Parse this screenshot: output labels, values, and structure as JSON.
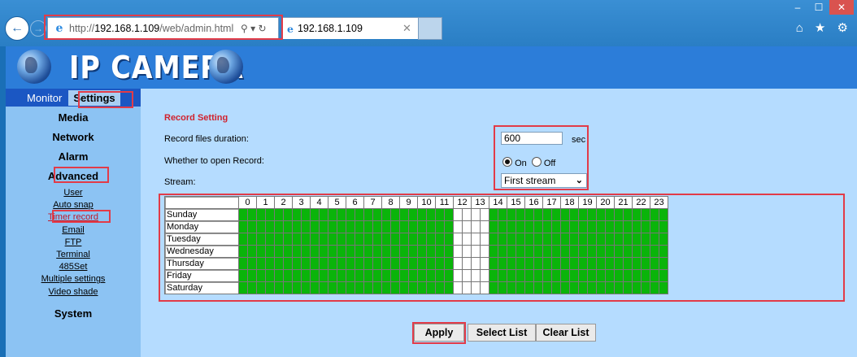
{
  "browser": {
    "url": "http://192.168.1.109/web/admin.html",
    "url_prefix": "http://",
    "url_host": "192.168.1.109",
    "url_path": "/web/admin.html",
    "tab_title": "192.168.1.109",
    "search_glyph": "⚲ ▾ ↻",
    "window_minimize": "–",
    "window_maximize": "☐",
    "window_close": "✕",
    "toolbar_icons": "⌂ ★ ⚙",
    "ie_glyph": "e"
  },
  "banner": {
    "title": "IP CAMERA"
  },
  "topnav": {
    "monitor": "Monitor",
    "settings": "Settings"
  },
  "sidebar": {
    "media": "Media",
    "network": "Network",
    "alarm": "Alarm",
    "advanced": "Advanced",
    "sub_items": [
      "User",
      "Auto snap",
      "Timer record",
      "Email",
      "FTP",
      "Terminal",
      "485Set",
      "Multiple settings",
      "Video shade"
    ],
    "system": "System"
  },
  "form": {
    "section_title": "Record Setting",
    "duration_label": "Record files duration:",
    "duration_value": "600",
    "duration_unit": "sec",
    "record_label": "Whether to open Record:",
    "on_label": "On",
    "off_label": "Off",
    "record_selected": "On",
    "stream_label": "Stream:",
    "stream_value": "First stream"
  },
  "schedule": {
    "hours": [
      "0",
      "1",
      "2",
      "3",
      "4",
      "5",
      "6",
      "7",
      "8",
      "9",
      "10",
      "11",
      "12",
      "13",
      "14",
      "15",
      "16",
      "17",
      "18",
      "19",
      "20",
      "21",
      "22",
      "23"
    ],
    "days": [
      "Sunday",
      "Monday",
      "Tuesday",
      "Wednesday",
      "Thursday",
      "Friday",
      "Saturday"
    ],
    "half_hour_slots_per_hour": 2,
    "recording_hours_off": [
      12,
      13
    ],
    "on_color": "#0ab40a",
    "off_color": "#ffffff"
  },
  "buttons": {
    "apply": "Apply",
    "select_list": "Select List",
    "clear_list": "Clear List"
  },
  "colors": {
    "highlight": "#e23b48",
    "nav_bar": "#1b57c3",
    "banner": "#2c7dd9"
  }
}
